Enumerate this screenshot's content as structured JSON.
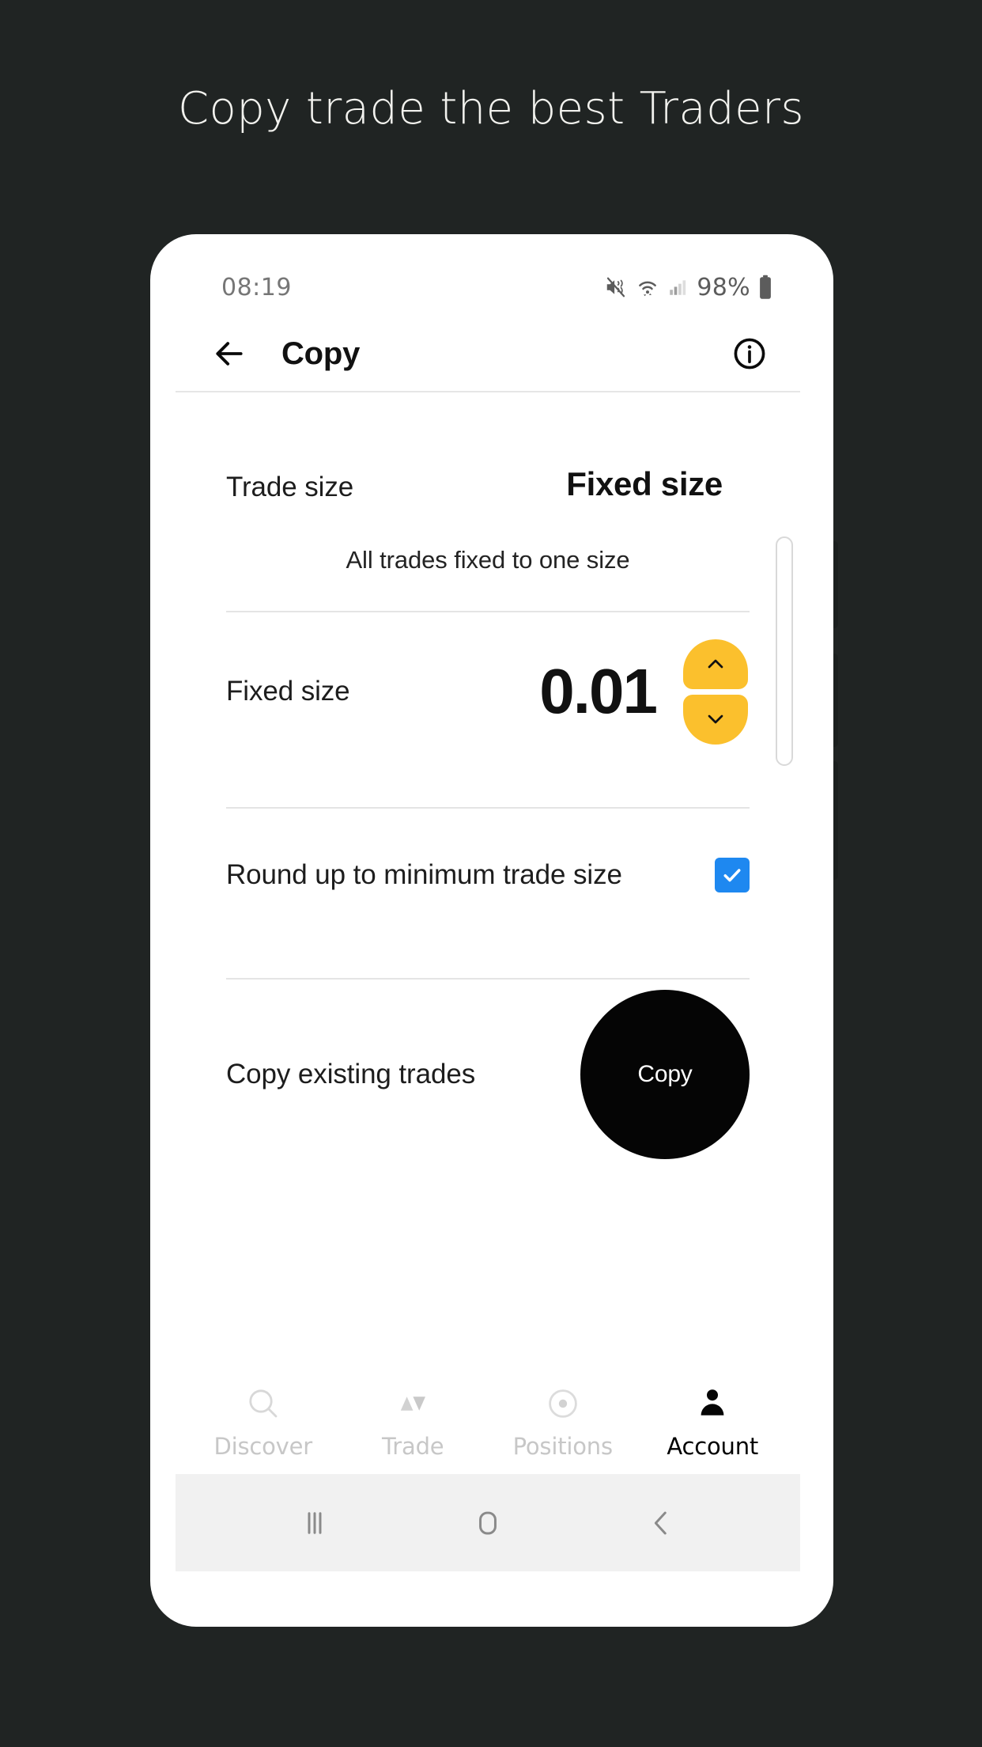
{
  "promo": {
    "headline": "Copy trade the best Traders"
  },
  "phone": {
    "statusbar": {
      "time": "08:19",
      "battery_percent": "98%",
      "icons": [
        "mute-vibrate-icon",
        "wifi-icon",
        "signal-bars-icon",
        "battery-icon"
      ]
    },
    "appbar": {
      "back_icon": "arrow-left-icon",
      "title": "Copy",
      "info_icon": "info-circle-icon"
    },
    "settings": {
      "trade_size": {
        "label": "Trade size",
        "value": "Fixed size",
        "description": "All trades fixed to one size"
      },
      "fixed_size": {
        "label": "Fixed size",
        "value": "0.01",
        "increment_icon": "chevron-up-icon",
        "decrement_icon": "chevron-down-icon",
        "stepper_color": "#FBC02D"
      },
      "round_up": {
        "label": "Round up to minimum trade size",
        "checked": true,
        "checkbox_color": "#1E88F0"
      },
      "copy_existing": {
        "label": "Copy existing trades",
        "button_label": "Copy",
        "button_color": "#050505"
      }
    },
    "bottom_nav": {
      "items": [
        {
          "label": "Discover",
          "icon": "search-icon",
          "active": false
        },
        {
          "label": "Trade",
          "icon": "triangles-icon",
          "active": false
        },
        {
          "label": "Positions",
          "icon": "circle-dot-icon",
          "active": false
        },
        {
          "label": "Account",
          "icon": "person-icon",
          "active": true
        }
      ]
    },
    "system_nav": {
      "recents_icon": "recents-bars-icon",
      "home_icon": "home-square-icon",
      "back_icon": "back-chevron-icon"
    }
  },
  "theme": {
    "background": "#202423",
    "accent_yellow": "#FBC02D",
    "accent_blue": "#1E88F0"
  }
}
